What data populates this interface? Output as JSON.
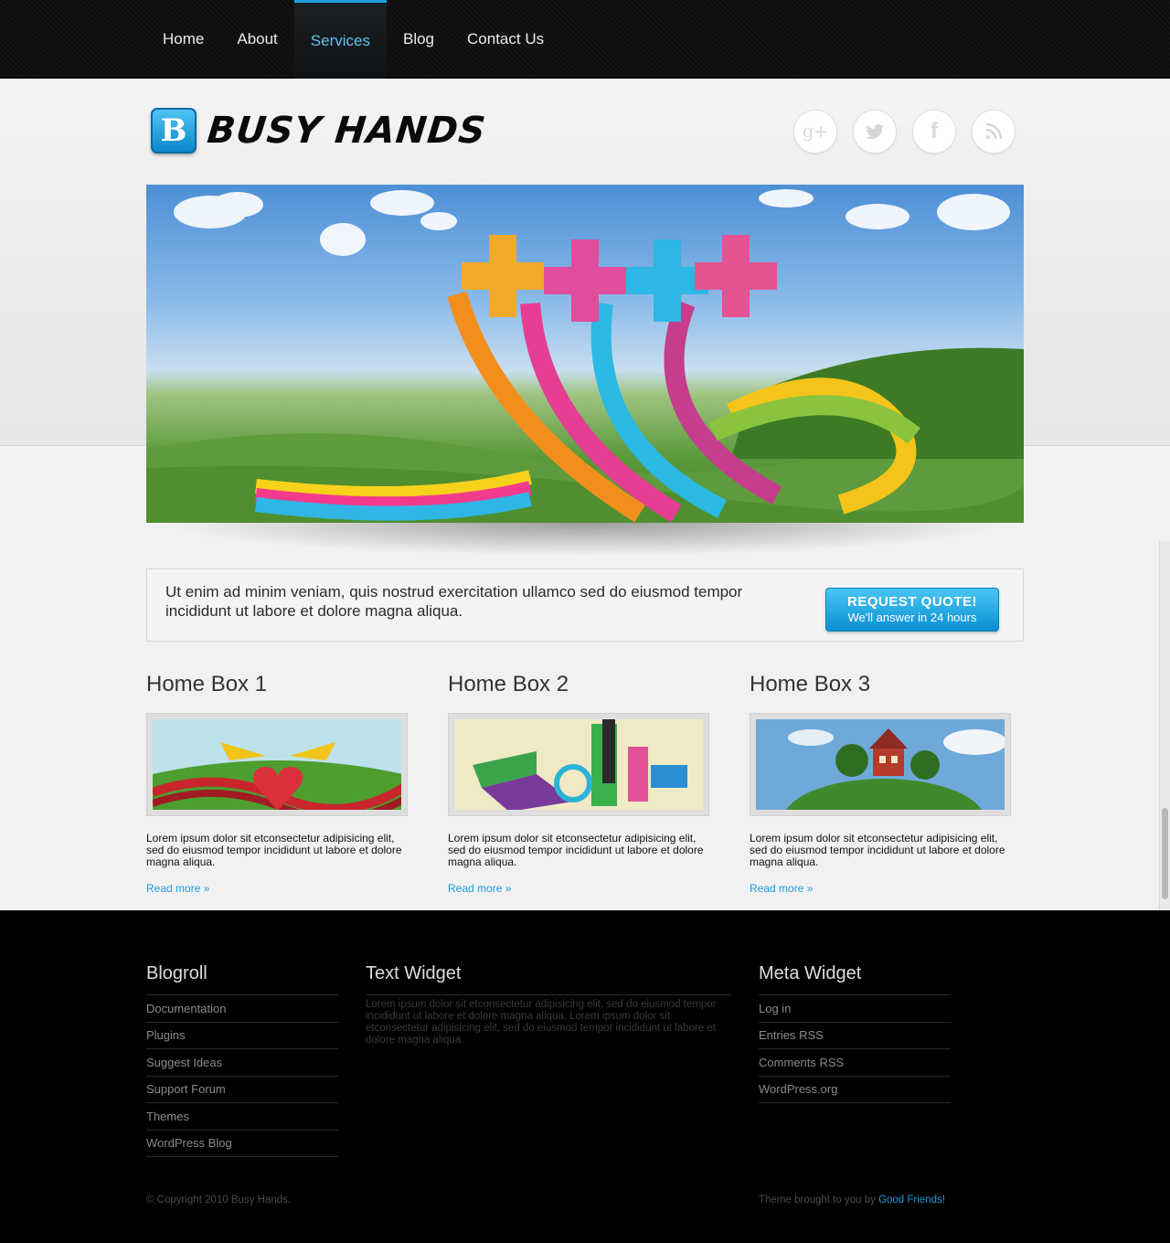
{
  "nav": {
    "items": [
      {
        "label": "Home"
      },
      {
        "label": "About"
      },
      {
        "label": "Services"
      },
      {
        "label": "Blog"
      },
      {
        "label": "Contact Us"
      }
    ],
    "active": "Services"
  },
  "brand": {
    "logo_letter": "B",
    "name": "BUSY HANDS"
  },
  "socials": [
    {
      "icon": "google-plus-icon",
      "glyph": "g+"
    },
    {
      "icon": "twitter-icon"
    },
    {
      "icon": "facebook-icon",
      "glyph": "f"
    },
    {
      "icon": "rss-icon"
    }
  ],
  "quote": {
    "text": "Ut enim ad minim veniam, quis nostrud exercitation ullamco sed do eiusmod tempor incididunt ut labore et dolore magna aliqua.",
    "button_title": "REQUEST QUOTE!",
    "button_subtitle": "We'll answer in 24 hours"
  },
  "boxes": [
    {
      "title": "Home Box 1",
      "text": "Lorem ipsum dolor sit etconsectetur adipisicing elit, sed do eiusmod tempor incididunt ut labore et dolore magna aliqua.",
      "link": "Read more »"
    },
    {
      "title": "Home Box 2",
      "text": "Lorem ipsum dolor sit etconsectetur adipisicing elit, sed do eiusmod tempor incididunt ut labore et dolore magna aliqua.",
      "link": "Read more »"
    },
    {
      "title": "Home Box 3",
      "text": "Lorem ipsum dolor sit etconsectetur adipisicing elit, sed do eiusmod tempor incididunt ut labore et dolore magna aliqua.",
      "link": "Read more »"
    }
  ],
  "footer": {
    "blogroll": {
      "title": "Blogroll",
      "items": [
        "Documentation",
        "Plugins",
        "Suggest Ideas",
        "Support Forum",
        "Themes",
        "WordPress Blog"
      ]
    },
    "text_widget": {
      "title": "Text Widget",
      "text": "Lorem ipsum dolor sit etconsectetur adipisicing elit, sed do eiusmod tempor incididunt ut labore et dolore magna aliqua. Lorem ipsum dolor sit etconsectetur adipisicing elit, sed do eiusmod tempor incididunt ut labore et dolore magna aliqua."
    },
    "meta": {
      "title": "Meta Widget",
      "items": [
        "Log in",
        "Entries RSS",
        "Comments RSS",
        "WordPress.org"
      ]
    },
    "copyright": "© Copyright 2010 Busy Hands.",
    "credit_prefix": "Theme brought to you by",
    "credit_link": "Good Friends!"
  },
  "colors": {
    "accent": "#1a9be0",
    "nav_bg": "#111111",
    "footer_bg": "#000000"
  }
}
